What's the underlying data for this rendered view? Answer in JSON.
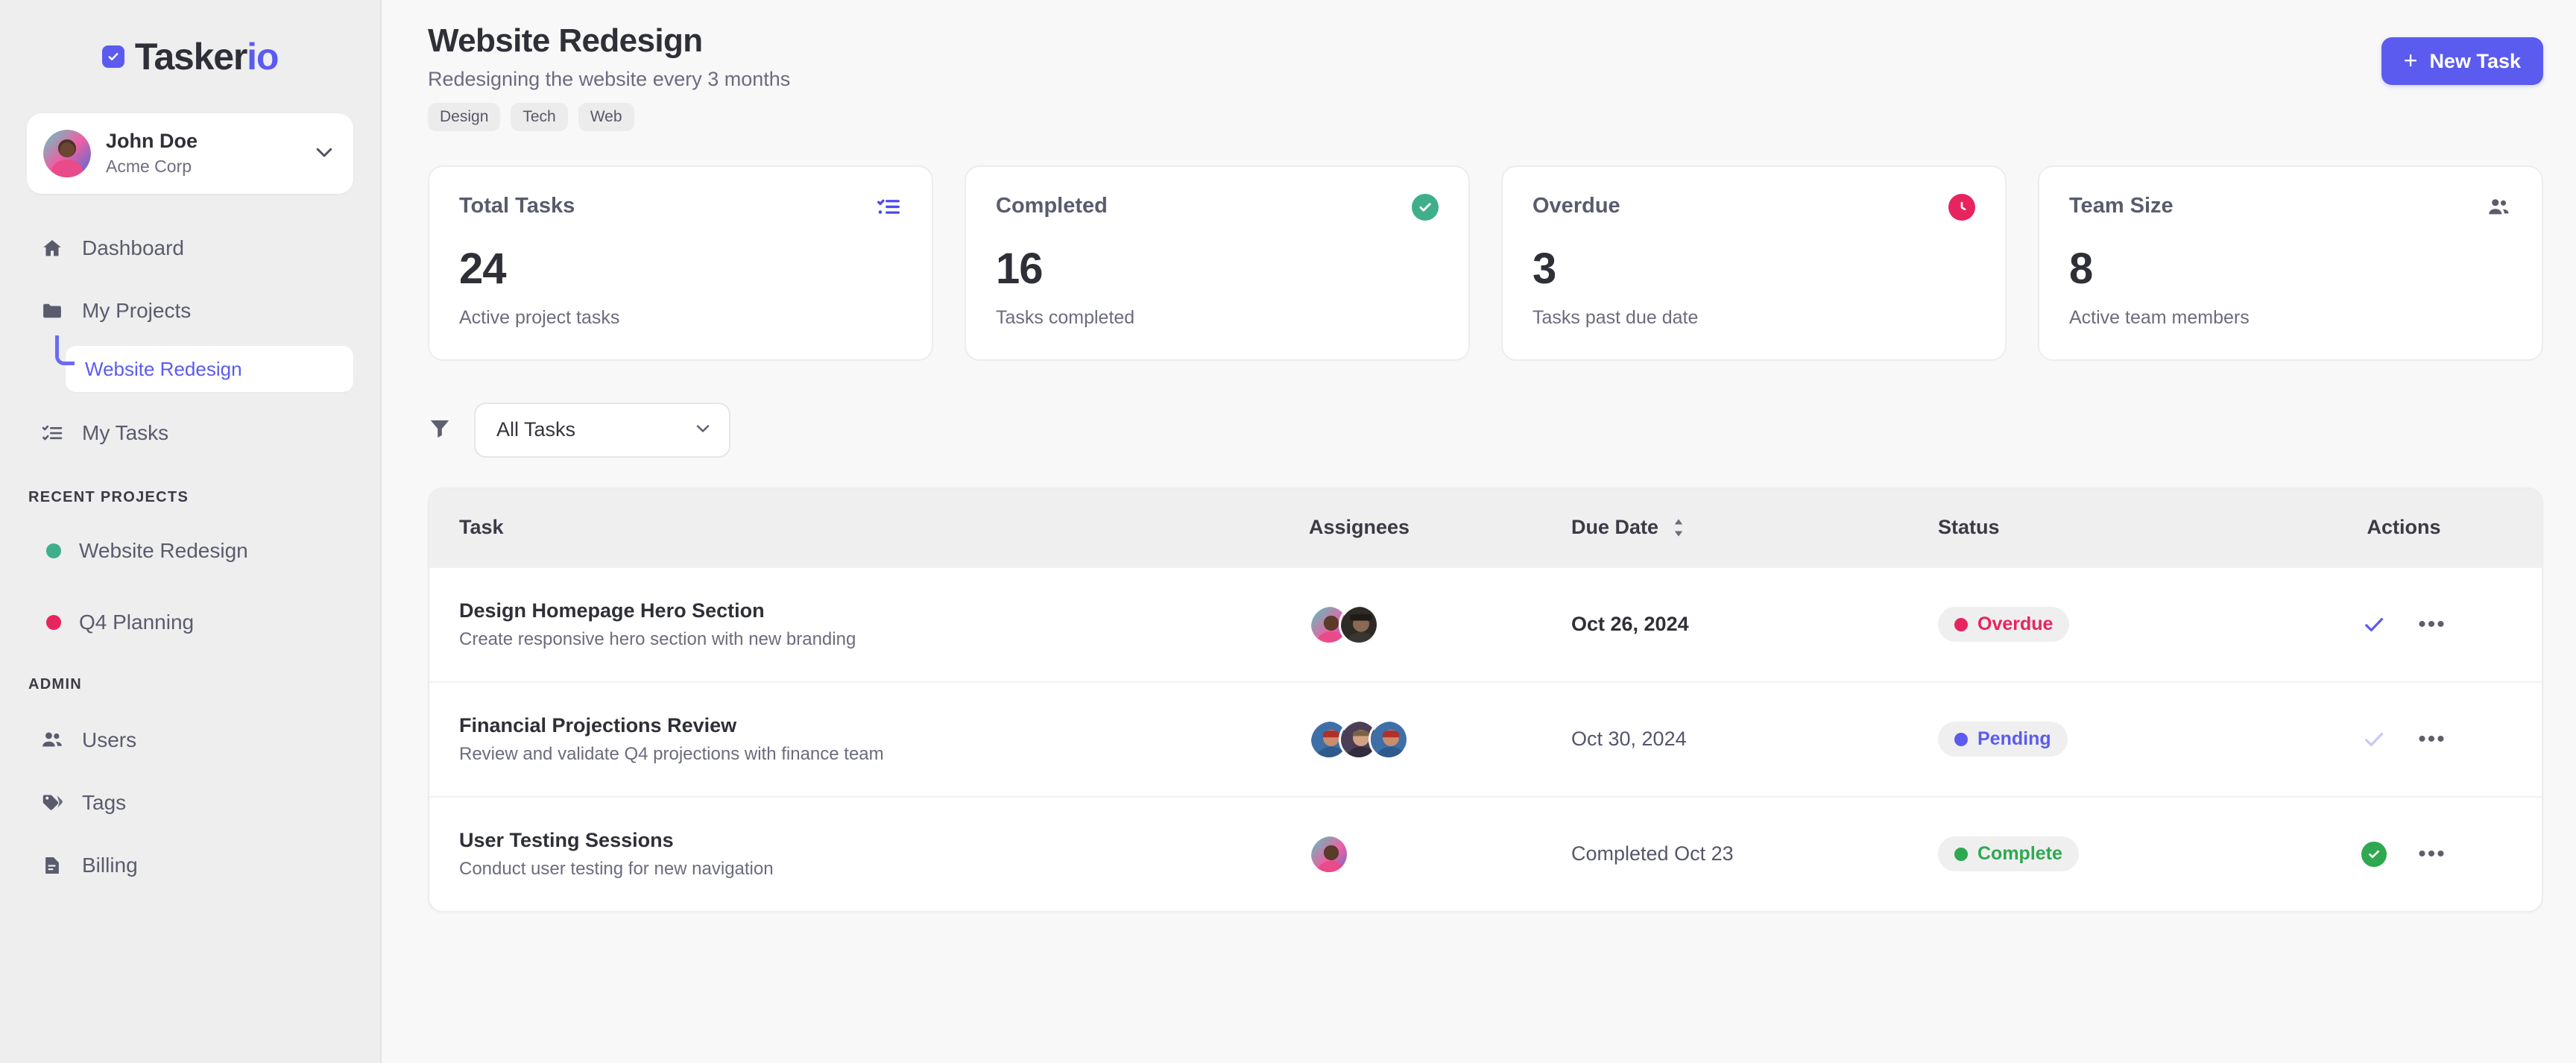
{
  "brand": {
    "name_dark": "Tasker",
    "name_accent": "io",
    "logo_icon": "checkbox-check-icon"
  },
  "colors": {
    "accent": "#5b5bf0",
    "green": "#3fae8b",
    "pink": "#e8245f",
    "sidebar_bg": "#eeeeef",
    "main_bg": "#f8f8f9"
  },
  "user": {
    "name": "John Doe",
    "org": "Acme Corp",
    "chevron_icon": "chevron-down-icon",
    "avatar_icon": "avatar"
  },
  "sidebar": {
    "nav": [
      {
        "label": "Dashboard",
        "icon": "home-icon"
      },
      {
        "label": "My Projects",
        "icon": "folder-icon"
      },
      {
        "label": "My Tasks",
        "icon": "checklist-icon"
      }
    ],
    "active_sub_item": "Website Redesign",
    "recent_projects_label": "Recent Projects",
    "recent_projects": [
      {
        "label": "Website Redesign",
        "dot_color": "#3fae8b"
      },
      {
        "label": "Q4 Planning",
        "dot_color": "#e8245f"
      }
    ],
    "admin_label": "Admin",
    "admin": [
      {
        "label": "Users",
        "icon": "users-icon"
      },
      {
        "label": "Tags",
        "icon": "tag-icon"
      },
      {
        "label": "Billing",
        "icon": "invoice-icon"
      }
    ]
  },
  "header": {
    "title": "Website Redesign",
    "subtitle": "Redesigning the website every 3 months",
    "tags": [
      "Design",
      "Tech",
      "Web"
    ],
    "new_task_label": "New Task",
    "new_task_icon": "plus-icon"
  },
  "stats": [
    {
      "label": "Total Tasks",
      "value": "24",
      "desc": "Active project tasks",
      "icon": "checklist-icon",
      "icon_color": "#4b4bf0",
      "icon_bg": "none"
    },
    {
      "label": "Completed",
      "value": "16",
      "desc": "Tasks completed",
      "icon": "check-circle-icon",
      "icon_color": "#ffffff",
      "icon_bg": "#3fae8b"
    },
    {
      "label": "Overdue",
      "value": "3",
      "desc": "Tasks past due date",
      "icon": "clock-icon",
      "icon_color": "#ffffff",
      "icon_bg": "#e8245f"
    },
    {
      "label": "Team Size",
      "value": "8",
      "desc": "Active team members",
      "icon": "users-icon",
      "icon_color": "#5a5c6d",
      "icon_bg": "none"
    }
  ],
  "filter": {
    "icon": "funnel-icon",
    "selected": "All Tasks",
    "caret_icon": "chevron-down-icon",
    "options": [
      "All Tasks"
    ]
  },
  "table": {
    "columns": [
      "Task",
      "Assignees",
      "Due Date",
      "Status",
      "Actions"
    ],
    "sort_column": "Due Date",
    "sort_icon": "sort-updown-icon",
    "rows": [
      {
        "name": "Design Homepage Hero Section",
        "desc": "Create responsive hero section with new branding",
        "assignee_count": 2,
        "due": "Oct 26, 2024",
        "due_emphasis": "bold",
        "status": "Overdue",
        "status_color": "#e8245f",
        "complete_icon": "check-icon",
        "complete_state": "active",
        "menu_icon": "ellipsis-icon"
      },
      {
        "name": "Financial Projections Review",
        "desc": "Review and validate Q4 projections with finance team",
        "assignee_count": 3,
        "due": "Oct 30, 2024",
        "due_emphasis": "normal",
        "status": "Pending",
        "status_color": "#5b5bf0",
        "complete_icon": "check-icon",
        "complete_state": "faded",
        "menu_icon": "ellipsis-icon"
      },
      {
        "name": "User Testing Sessions",
        "desc": "Conduct user testing for new navigation",
        "assignee_count": 1,
        "due": "Completed Oct 23",
        "due_emphasis": "normal",
        "status": "Complete",
        "status_color": "#2fa84f",
        "complete_icon": "check-circle-icon",
        "complete_state": "done",
        "menu_icon": "ellipsis-icon"
      }
    ]
  }
}
